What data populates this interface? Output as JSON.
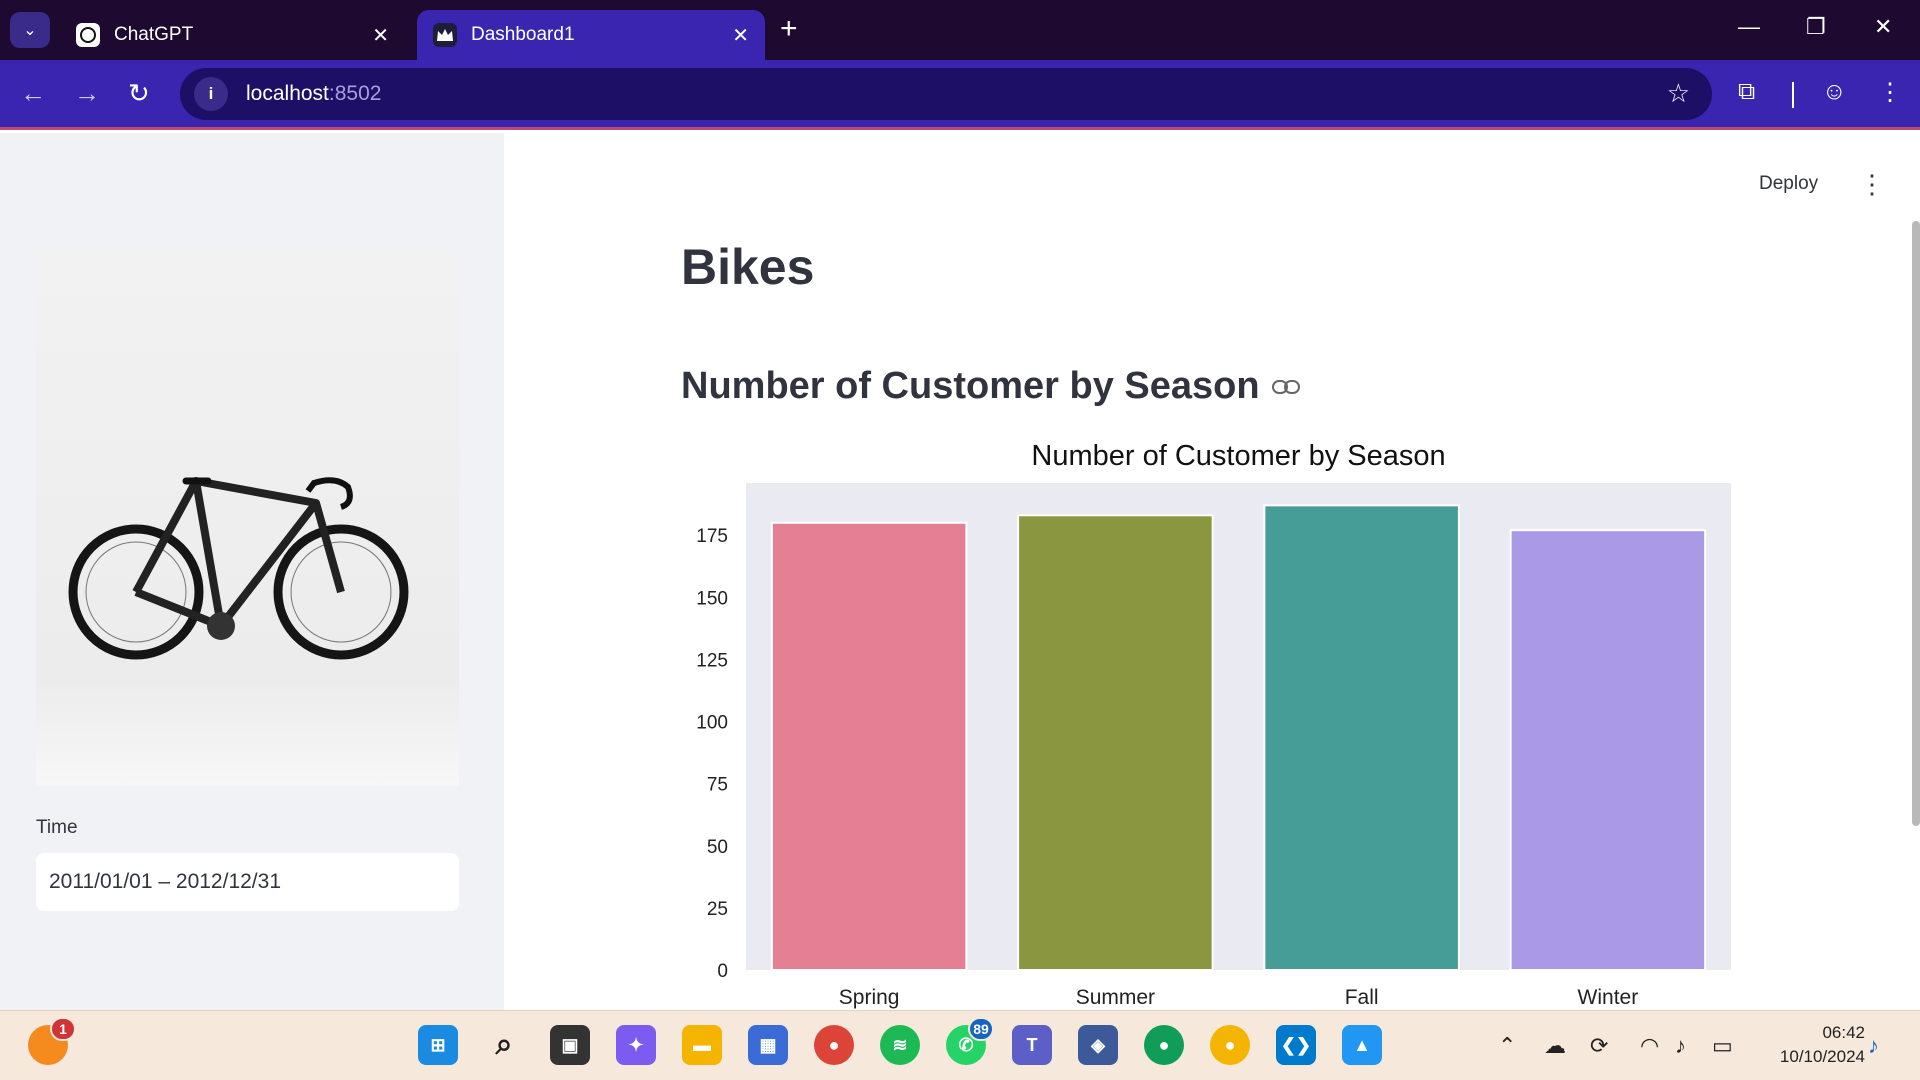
{
  "browser": {
    "tabs": [
      {
        "title": "ChatGPT",
        "active": false
      },
      {
        "title": "Dashboard1",
        "active": true
      }
    ],
    "url_host": "localhost",
    "url_port": ":8502"
  },
  "sidebar": {
    "time_label": "Time",
    "date_range": "2011/01/01 – 2012/12/31"
  },
  "main": {
    "deploy_label": "Deploy",
    "page_title": "Bikes",
    "chart_heading": "Number of Customer by Season"
  },
  "chart_data": {
    "type": "bar",
    "title": "Number of Customer by Season",
    "xlabel": "",
    "ylabel": "",
    "categories": [
      "Spring",
      "Summer",
      "Fall",
      "Winter"
    ],
    "values": [
      180,
      183,
      187,
      177
    ],
    "colors": [
      "#e58094",
      "#8b9640",
      "#469d97",
      "#aa99e6"
    ],
    "yticks": [
      0,
      25,
      50,
      75,
      100,
      125,
      150,
      175
    ],
    "ylim": [
      0,
      196
    ],
    "background": "#eaeaf2",
    "grid": false
  },
  "taskbar": {
    "whatsapp_badge": "89",
    "notif_badge": "1",
    "time": "06:42",
    "date": "10/10/2024"
  }
}
